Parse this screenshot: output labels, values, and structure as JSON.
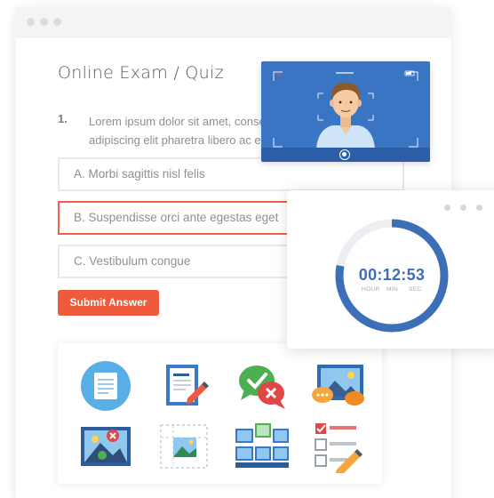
{
  "exam": {
    "title": "Online Exam / Quiz",
    "question": {
      "number": "1.",
      "text": "Lorem ipsum dolor sit amet, consectetur adipiscing elit pharetra libero ac eros ultrices e"
    },
    "options": [
      {
        "label": "A. Morbi sagittis nisl felis",
        "selected": false
      },
      {
        "label": "B. Suspendisse orci ante egestas eget",
        "selected": true
      },
      {
        "label": "C. Vestibulum congue",
        "selected": false
      }
    ],
    "submit_label": "Submit Answer"
  },
  "timer": {
    "time": "00:12:53",
    "units": [
      "HOUR",
      "MIN",
      "SEC"
    ],
    "progress": 0.78
  },
  "icons": [
    "document-circle-icon",
    "edit-document-icon",
    "approve-reject-chat-icon",
    "image-chat-icon",
    "image-reject-icon",
    "image-crop-icon",
    "image-gallery-icon",
    "checklist-edit-icon"
  ],
  "colors": {
    "accent": "#ef5a3c",
    "primary_blue": "#3d6fb8",
    "webcam_bg": "#3a75c4"
  }
}
